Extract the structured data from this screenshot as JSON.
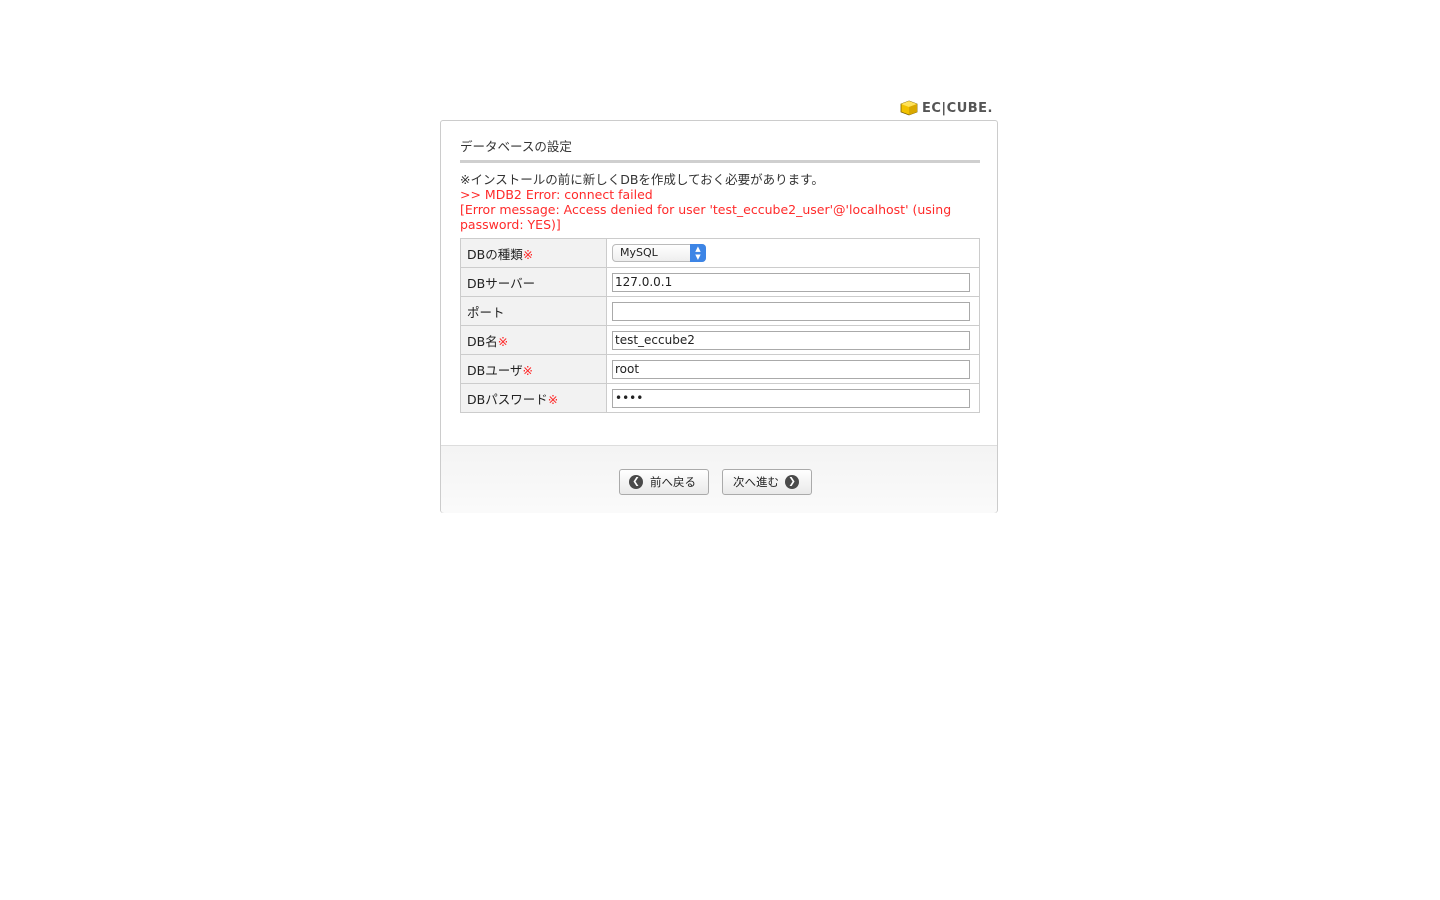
{
  "logo": {
    "text": "EC|CUBE."
  },
  "page": {
    "heading": "データベースの設定",
    "note": "※インストールの前に新しくDBを作成しておく必要があります。",
    "error_line1": ">> MDB2 Error: connect failed",
    "error_line2": "[Error message: Access denied for user 'test_eccube2_user'@'localhost' (using password: YES)]"
  },
  "form": {
    "required_mark": "※",
    "db_type": {
      "label": "DBの種類",
      "value": "MySQL"
    },
    "db_server": {
      "label": "DBサーバー",
      "value": "127.0.0.1"
    },
    "port": {
      "label": "ポート",
      "value": ""
    },
    "db_name": {
      "label": "DB名",
      "value": "test_eccube2"
    },
    "db_user": {
      "label": "DBユーザ",
      "value": "root"
    },
    "db_password": {
      "label": "DBパスワード",
      "value": "••••"
    }
  },
  "buttons": {
    "prev": "前へ戻る",
    "next": "次へ進む"
  },
  "colors": {
    "error": "#ff2a2a",
    "select_accent": "#3d85e6",
    "logo_cube": "#f2c200"
  }
}
